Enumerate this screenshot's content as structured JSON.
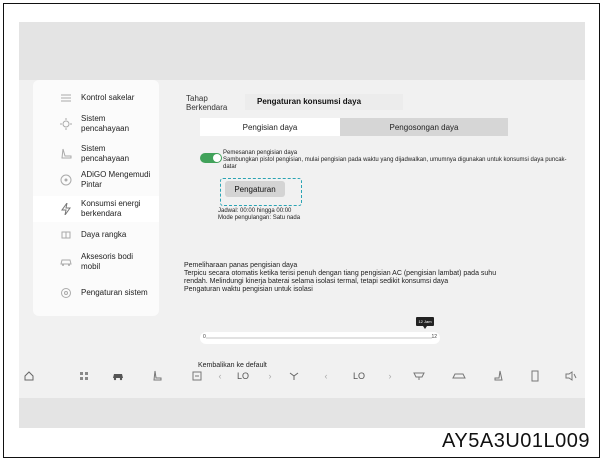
{
  "sidebar": {
    "items": [
      {
        "label": "Kontrol sakelar",
        "icon": "switch-icon"
      },
      {
        "label": "Sistem pencahayaan",
        "icon": "light-icon"
      },
      {
        "label": "Sistem pencahayaan",
        "icon": "seat-icon"
      },
      {
        "label": "ADiGO Mengemudi Pintar",
        "icon": "adigo-icon"
      },
      {
        "label": "Konsumsi energi berkendara",
        "icon": "energy-icon"
      },
      {
        "label": "Daya rangka",
        "icon": "chassis-icon"
      },
      {
        "label": "Aksesoris bodi mobil",
        "icon": "car-body-icon"
      },
      {
        "label": "Pengaturan sistem",
        "icon": "system-settings-icon"
      }
    ],
    "active_index": 4
  },
  "header": {
    "breadcrumb": "Tahap Berkendara",
    "title": "Pengaturan konsumsi daya"
  },
  "tabs": [
    {
      "label": "Pengisian daya",
      "selected": true
    },
    {
      "label": "Pengosongan daya",
      "selected": false
    }
  ],
  "schedule": {
    "toggle_on": true,
    "title": "Pemesanan pengisian daya",
    "description": "Sambungkan pistol pengisian, mulai pengisian pada waktu yang dijadwalkan, umumnya digunakan untuk konsumsi daya puncak-datar",
    "settings_button": "Pengaturan",
    "schedule_text": "Jadwal: 00:00 hingga 00:00",
    "repeat_text": "Mode pengulangan: Satu nada"
  },
  "maintenance": {
    "title": "Pemeliharaan panas pengisian daya",
    "line1": "Terpicu secara otomatis ketika terisi penuh dengan tiang pengisian AC (pengisian lambat) pada suhu",
    "line2": "rendah. Melindungi kinerja baterai selama isolasi termal, tetapi sedikit konsumsi daya",
    "line3": "Pengaturan waktu pengisian untuk isolasi"
  },
  "slider": {
    "tooltip": "12 Jam",
    "min_label": "0",
    "max_label": "12",
    "value_fraction": 1.0
  },
  "reset_label": "Kembalikan ke default",
  "bottom_bar": {
    "items": [
      {
        "icon": "home-icon"
      },
      {
        "icon": "apps-icon"
      },
      {
        "icon": "car-icon"
      },
      {
        "icon": "seat-heat-icon"
      },
      {
        "icon": "fan-mode-icon"
      },
      {
        "text": "LO"
      },
      {
        "icon": "fan-icon"
      },
      {
        "text": "LO"
      },
      {
        "icon": "front-defrost-icon"
      },
      {
        "icon": "recirculation-icon"
      },
      {
        "icon": "seat-icon"
      },
      {
        "icon": "phone-icon"
      },
      {
        "icon": "volume-icon"
      }
    ]
  },
  "caption": "AY5A3U01L009"
}
